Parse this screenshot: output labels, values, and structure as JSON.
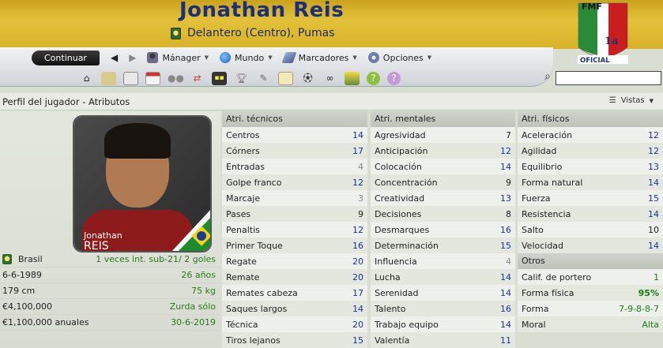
{
  "header": {
    "player_name": "Jonathan Reis",
    "position_club": "Delantero (Centro), Pumas",
    "logo_text_top": "FMF",
    "logo_text_bottom": "OFICIAL",
    "logo_badge": "1a"
  },
  "toolbar": {
    "continue_label": "Continuar",
    "back_icon": "back-arrow-icon",
    "forward_icon": "forward-arrow-icon",
    "menus": [
      {
        "label": "Mánager",
        "icon": "manager-icon"
      },
      {
        "label": "Mundo",
        "icon": "globe-icon"
      },
      {
        "label": "Marcadores",
        "icon": "bookmark-icon"
      },
      {
        "label": "Opciones",
        "icon": "options-icon"
      }
    ],
    "quick_icons": [
      "home-icon",
      "inbox-icon",
      "notebook-icon",
      "calendar-icon",
      "squad-icon",
      "transfers-icon",
      "tactics-icon",
      "trophy-icon",
      "scout-icon",
      "clipboard-icon",
      "match-icon",
      "binoculars-icon",
      "finance-icon",
      "help-icon",
      "extra-icon"
    ],
    "search_placeholder": ""
  },
  "titlebar": {
    "title": "Perfil del jugador - Atributos",
    "vistas_label": "Vistas"
  },
  "player_card": {
    "first_name": "Jonathan",
    "last_name": "REIS"
  },
  "info": [
    {
      "left": "Brasil",
      "right": "1 veces int. sub-21/ 2 goles",
      "crest": true
    },
    {
      "left": "6-6-1989",
      "right": "26 años"
    },
    {
      "left": "179 cm",
      "right": "75 kg"
    },
    {
      "left": "€4,100,000",
      "right": "Zurda sólo"
    },
    {
      "left": "€1,100,000 anuales",
      "right": "30-6-2019"
    }
  ],
  "tecnicos": {
    "title": "Atri. técnicos",
    "rows": [
      {
        "name": "Centros",
        "value": "14"
      },
      {
        "name": "Córners",
        "value": "17"
      },
      {
        "name": "Entradas",
        "value": "4"
      },
      {
        "name": "Golpe franco",
        "value": "12"
      },
      {
        "name": "Marcaje",
        "value": "3"
      },
      {
        "name": "Pases",
        "value": "9"
      },
      {
        "name": "Penaltis",
        "value": "12"
      },
      {
        "name": "Primer Toque",
        "value": "16"
      },
      {
        "name": "Regate",
        "value": "20"
      },
      {
        "name": "Remate",
        "value": "20"
      },
      {
        "name": "Remates cabeza",
        "value": "17"
      },
      {
        "name": "Saques largos",
        "value": "14"
      },
      {
        "name": "Técnica",
        "value": "20"
      },
      {
        "name": "Tiros lejanos",
        "value": "15"
      }
    ]
  },
  "mentales": {
    "title": "Atri. mentales",
    "rows": [
      {
        "name": "Agresividad",
        "value": "7"
      },
      {
        "name": "Anticipación",
        "value": "12"
      },
      {
        "name": "Colocación",
        "value": "14"
      },
      {
        "name": "Concentración",
        "value": "9"
      },
      {
        "name": "Creatividad",
        "value": "13"
      },
      {
        "name": "Decisiones",
        "value": "8"
      },
      {
        "name": "Desmarques",
        "value": "16"
      },
      {
        "name": "Determinación",
        "value": "15"
      },
      {
        "name": "Influencia",
        "value": "4"
      },
      {
        "name": "Lucha",
        "value": "14"
      },
      {
        "name": "Serenidad",
        "value": "14"
      },
      {
        "name": "Talento",
        "value": "16"
      },
      {
        "name": "Trabajo equipo",
        "value": "14"
      },
      {
        "name": "Valentía",
        "value": "11"
      }
    ]
  },
  "fisicos": {
    "title": "Atri. físicos",
    "rows": [
      {
        "name": "Aceleración",
        "value": "12"
      },
      {
        "name": "Agilidad",
        "value": "12"
      },
      {
        "name": "Equilibrio",
        "value": "13"
      },
      {
        "name": "Forma natural",
        "value": "14"
      },
      {
        "name": "Fuerza",
        "value": "15"
      },
      {
        "name": "Resistencia",
        "value": "14"
      },
      {
        "name": "Salto",
        "value": "10"
      },
      {
        "name": "Velocidad",
        "value": "14"
      }
    ]
  },
  "otros": {
    "title": "Otros",
    "rows": [
      {
        "name": "Calif. de portero",
        "value": "1"
      },
      {
        "name": "Forma física",
        "value": "95%"
      },
      {
        "name": "Forma",
        "value": "7-9-8-8-7"
      },
      {
        "name": "Moral",
        "value": "Alta"
      }
    ]
  },
  "colors": {
    "header_gold": "#d7b22a",
    "name_blue": "#1e2f7a",
    "value_blue": "#1c2ea8",
    "value_green": "#1a7a1a"
  }
}
